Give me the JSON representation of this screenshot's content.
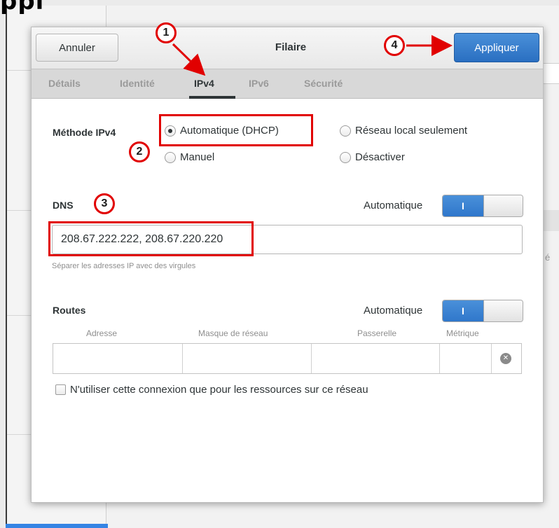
{
  "background": {
    "heading_partial": "ppl",
    "side_char": "é"
  },
  "dialog": {
    "title": "Filaire",
    "cancel_label": "Annuler",
    "apply_label": "Appliquer",
    "tabs": [
      {
        "label": "Détails",
        "active": false
      },
      {
        "label": "Identité",
        "active": false
      },
      {
        "label": "IPv4",
        "active": true
      },
      {
        "label": "IPv6",
        "active": false
      },
      {
        "label": "Sécurité",
        "active": false
      }
    ]
  },
  "ipv4": {
    "method_label": "Méthode IPv4",
    "options": [
      {
        "label": "Automatique (DHCP)",
        "selected": true
      },
      {
        "label": "Réseau local seulement",
        "selected": false
      },
      {
        "label": "Manuel",
        "selected": false
      },
      {
        "label": "Désactiver",
        "selected": false
      }
    ]
  },
  "dns": {
    "label": "DNS",
    "auto_label": "Automatique",
    "switch_on_text": "I",
    "switch_on": true,
    "value": "208.67.222.222, 208.67.220.220",
    "hint": "Séparer les adresses IP avec des virgules"
  },
  "routes": {
    "label": "Routes",
    "auto_label": "Automatique",
    "switch_on_text": "I",
    "switch_on": true,
    "columns": [
      "Adresse",
      "Masque de réseau",
      "Passerelle",
      "Métrique"
    ],
    "only_local_label": "N'utiliser cette connexion que pour les ressources sur ce réseau",
    "only_local_checked": false
  },
  "annotations": {
    "markers": [
      "1",
      "2",
      "3",
      "4"
    ],
    "color": "#e10000"
  },
  "colors": {
    "accent": "#3584e4",
    "apply_button": "#2a6fc1"
  }
}
